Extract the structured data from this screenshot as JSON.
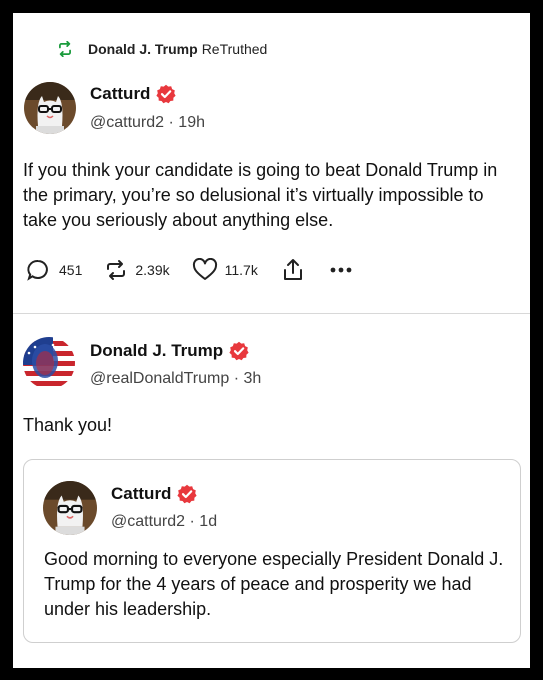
{
  "retruth": {
    "user": "Donald J. Trump",
    "action": "ReTruthed",
    "icon": "retruth-icon",
    "color": "#1a9b3c"
  },
  "post1": {
    "name": "Catturd",
    "handle": "@catturd2",
    "time": "19h",
    "sep": "·",
    "text": "If you think your candidate is going to beat Donald Trump in the primary, you’re so delusional it’s virtually impossible to take you seriously about anything else.",
    "stats": {
      "replies": "451",
      "retruths": "2.39k",
      "likes": "11.7k"
    },
    "icons": [
      "reply-icon",
      "retruth-icon",
      "like-icon",
      "share-icon",
      "more-icon"
    ]
  },
  "post2": {
    "name": "Donald J. Trump",
    "handle": "@realDonaldTrump",
    "time": "3h",
    "sep": "·",
    "text": "Thank you!",
    "quote": {
      "name": "Catturd",
      "handle": "@catturd2",
      "time": "1d",
      "sep": "·",
      "text": "Good morning to everyone especially President Donald J. Trump for the 4 years of peace and prosperity we had under his leadership."
    }
  },
  "colors": {
    "verified": "#e8383d",
    "retruth": "#1a9b3c",
    "text": "#111111",
    "muted": "#444444"
  }
}
